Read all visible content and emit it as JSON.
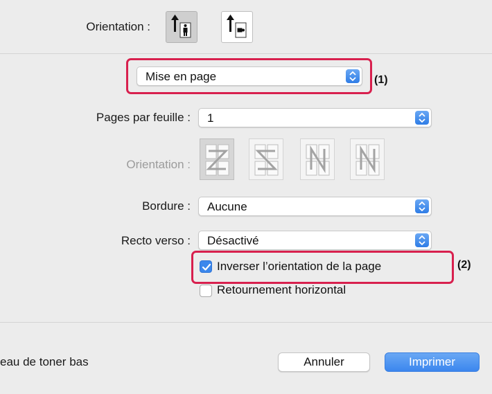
{
  "orientation": {
    "label": "Orientation :",
    "options": [
      {
        "name": "portrait",
        "selected": true
      },
      {
        "name": "landscape",
        "selected": false
      }
    ]
  },
  "section_select": {
    "value": "Mise en page",
    "callout": "(1)"
  },
  "pages_per_sheet": {
    "label": "Pages par feuille :",
    "value": "1"
  },
  "layout_direction": {
    "label": "Orientation :",
    "enabled": false
  },
  "border": {
    "label": "Bordure :",
    "value": "Aucune"
  },
  "duplex": {
    "label": "Recto verso :",
    "value": "Désactivé"
  },
  "reverse_orientation": {
    "label": "Inverser l’orientation de la page",
    "checked": true,
    "callout": "(2)"
  },
  "flip_horizontal": {
    "label": "Retournement horizontal",
    "checked": false
  },
  "footer": {
    "status_text": "eau de toner bas",
    "cancel_label": "Annuler",
    "print_label": "Imprimer"
  },
  "colors": {
    "accent": "#3b87ec",
    "callout": "#d8204e"
  }
}
